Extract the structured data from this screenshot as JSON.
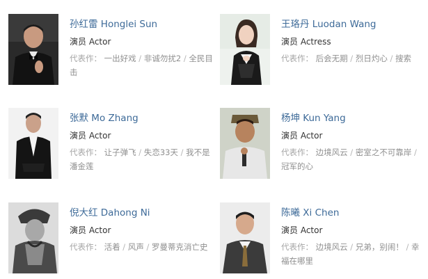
{
  "cast": [
    {
      "name": "孙红雷 Honglei Sun",
      "role": "演员 Actor",
      "works_label": "代表作：",
      "works": [
        "一出好戏",
        "非诚勿扰2",
        "全民目击"
      ],
      "separator": " / "
    },
    {
      "name": "王珞丹 Luodan Wang",
      "role": "演员 Actress",
      "works_label": "代表作：",
      "works": [
        "后会无期",
        "烈日灼心",
        "搜索"
      ],
      "separator": " / "
    },
    {
      "name": "张默 Mo Zhang",
      "role": "演员 Actor",
      "works_label": "代表作：",
      "works": [
        "让子弹飞",
        "失恋33天",
        "我不是潘金莲"
      ],
      "separator": " / "
    },
    {
      "name": "杨坤 Kun Yang",
      "role": "演员 Actor",
      "works_label": "代表作：",
      "works": [
        "边境风云",
        "密室之不可靠岸",
        "冠军的心"
      ],
      "separator": " / "
    },
    {
      "name": "倪大红 Dahong Ni",
      "role": "演员 Actor",
      "works_label": "代表作：",
      "works": [
        "活着",
        "风声",
        "罗曼蒂克消亡史"
      ],
      "separator": " / "
    },
    {
      "name": "陈曦 Xi Chen",
      "role": "演员 Actor",
      "works_label": "代表作：",
      "works": [
        "边境风云",
        "兄弟，别闹！",
        "幸福在哪里"
      ],
      "separator": " / "
    }
  ],
  "colors": {
    "name_link": "#3d6a98",
    "role_text": "#333333",
    "works_text": "#8f8f8f"
  }
}
